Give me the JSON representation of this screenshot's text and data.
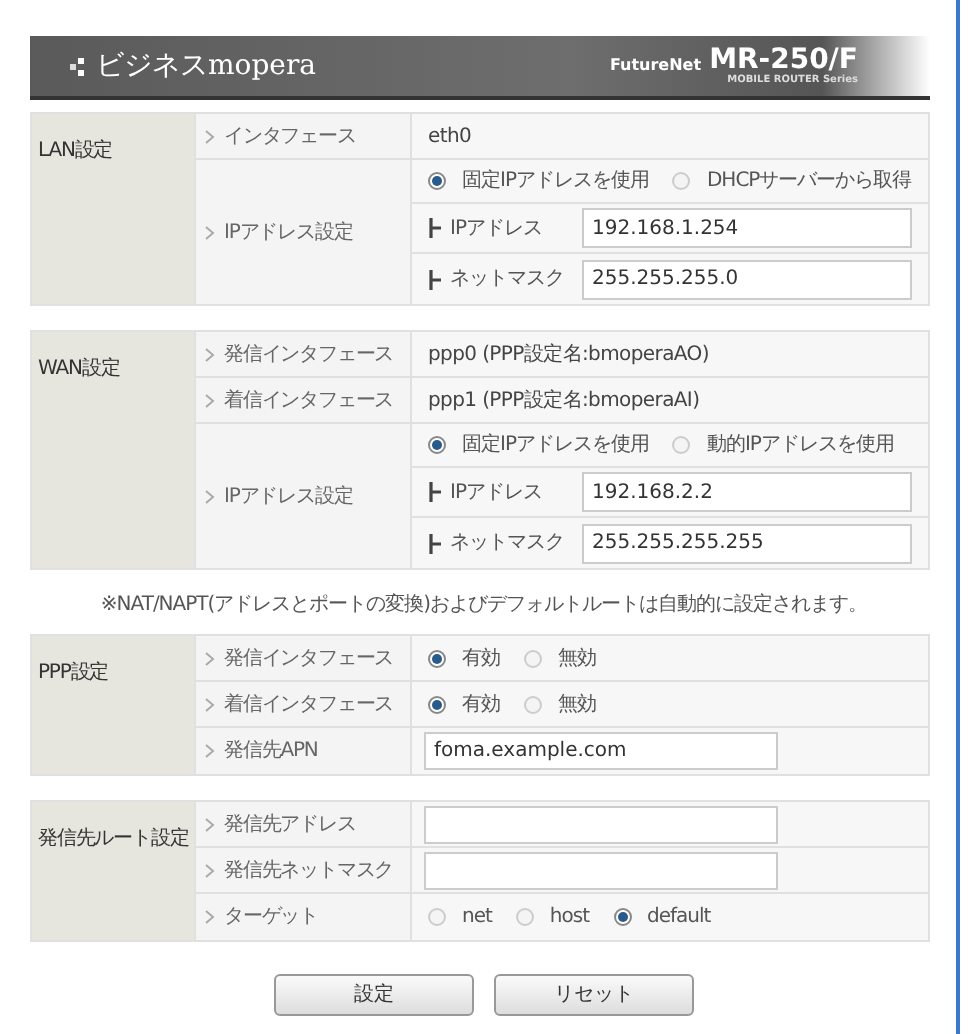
{
  "header": {
    "brand": "ビジネスmopera",
    "maker": "FutureNet",
    "model": "MR-250/F",
    "series": "MOBILE ROUTER Series"
  },
  "sections": [
    {
      "title": "LAN設定",
      "rows": [
        {
          "kind": "text",
          "label": "インタフェース",
          "value": "eth0"
        },
        {
          "kind": "group",
          "label": "IPアドレス設定",
          "items": [
            {
              "kind": "radio",
              "options": [
                {
                  "label": "固定IPアドレスを使用",
                  "selected": true
                },
                {
                  "label": "DHCPサーバーから取得",
                  "selected": false
                }
              ]
            },
            {
              "kind": "field",
              "label": "IPアドレス",
              "value": "192.168.1.254"
            },
            {
              "kind": "field",
              "label": "ネットマスク",
              "value": "255.255.255.0"
            }
          ]
        }
      ]
    },
    {
      "title": "WAN設定",
      "rows": [
        {
          "kind": "text",
          "label": "発信インタフェース",
          "value": "ppp0 (PPP設定名:bmoperaAO)"
        },
        {
          "kind": "text",
          "label": "着信インタフェース",
          "value": "ppp1 (PPP設定名:bmoperaAI)"
        },
        {
          "kind": "group",
          "label": "IPアドレス設定",
          "items": [
            {
              "kind": "radio",
              "options": [
                {
                  "label": "固定IPアドレスを使用",
                  "selected": true
                },
                {
                  "label": "動的IPアドレスを使用",
                  "selected": false
                }
              ]
            },
            {
              "kind": "field",
              "label": "IPアドレス",
              "value": "192.168.2.2"
            },
            {
              "kind": "field",
              "label": "ネットマスク",
              "value": "255.255.255.255"
            }
          ]
        }
      ],
      "note": "※NAT/NAPT(アドレスとポートの変換)およびデフォルトルートは自動的に設定されます。"
    },
    {
      "title": "PPP設定",
      "rows": [
        {
          "kind": "radio",
          "label": "発信インタフェース",
          "options": [
            {
              "label": "有効",
              "selected": true
            },
            {
              "label": "無効",
              "selected": false
            }
          ]
        },
        {
          "kind": "radio",
          "label": "着信インタフェース",
          "options": [
            {
              "label": "有効",
              "selected": true
            },
            {
              "label": "無効",
              "selected": false
            }
          ]
        },
        {
          "kind": "input",
          "label": "発信先APN",
          "value": "foma.example.com"
        }
      ]
    },
    {
      "title": "発信先ルート設定",
      "rows": [
        {
          "kind": "input",
          "label": "発信先アドレス"
        },
        {
          "kind": "input",
          "label": "発信先ネットマスク"
        },
        {
          "kind": "radio",
          "label": "ターゲット",
          "options": [
            {
              "label": "net",
              "selected": false
            },
            {
              "label": "host",
              "selected": false
            },
            {
              "label": "default",
              "selected": true
            }
          ]
        }
      ]
    }
  ],
  "buttons": [
    "設定",
    "リセット"
  ]
}
